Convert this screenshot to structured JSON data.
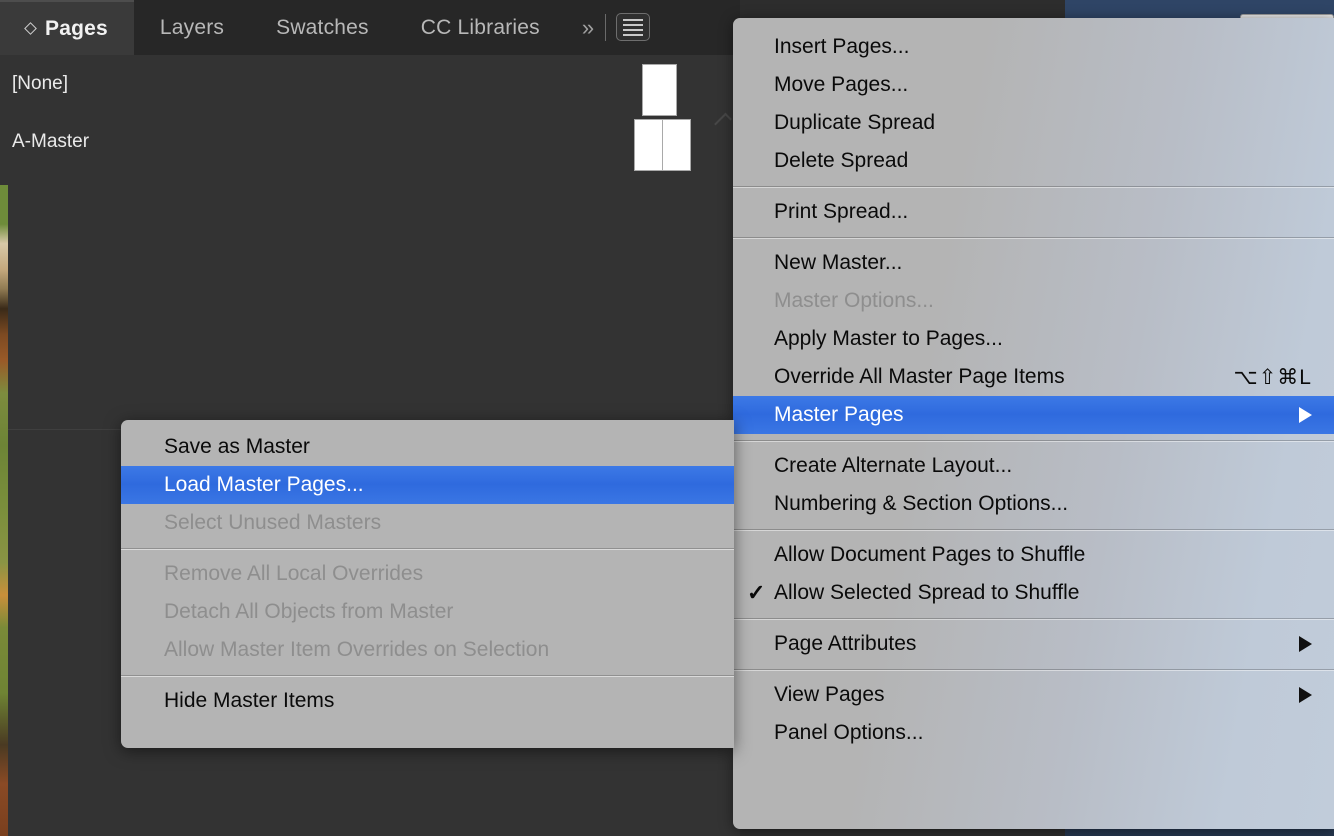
{
  "panel": {
    "tabs": [
      {
        "label": "Pages",
        "active": true,
        "icon": "diamond-icon"
      },
      {
        "label": "Layers",
        "active": false
      },
      {
        "label": "Swatches",
        "active": false
      },
      {
        "label": "CC Libraries",
        "active": false
      }
    ],
    "overflow_label": "»",
    "menu_button_icon": "hamburger-menu-icon",
    "masters": [
      {
        "name": "[None]",
        "thumb": "single-page"
      },
      {
        "name": "A-Master",
        "thumb": "two-page-spread"
      }
    ]
  },
  "context_menu": {
    "groups": [
      {
        "items": [
          {
            "label": "Insert Pages...",
            "state": "normal"
          },
          {
            "label": "Move Pages...",
            "state": "normal"
          },
          {
            "label": "Duplicate Spread",
            "state": "normal"
          },
          {
            "label": "Delete Spread",
            "state": "normal"
          }
        ]
      },
      {
        "items": [
          {
            "label": "Print Spread...",
            "state": "normal"
          }
        ]
      },
      {
        "items": [
          {
            "label": "New Master...",
            "state": "normal"
          },
          {
            "label": "Master Options...",
            "state": "disabled"
          },
          {
            "label": "Apply Master to Pages...",
            "state": "normal"
          },
          {
            "label": "Override All Master Page Items",
            "state": "normal",
            "shortcut": "⌥⇧⌘L"
          },
          {
            "label": "Master Pages",
            "state": "selected",
            "submenu": true
          }
        ]
      },
      {
        "items": [
          {
            "label": "Create Alternate Layout...",
            "state": "normal"
          },
          {
            "label": "Numbering & Section Options...",
            "state": "normal"
          }
        ]
      },
      {
        "items": [
          {
            "label": "Allow Document Pages to Shuffle",
            "state": "normal"
          },
          {
            "label": "Allow Selected Spread to Shuffle",
            "state": "normal",
            "checked": true
          }
        ]
      },
      {
        "items": [
          {
            "label": "Page Attributes",
            "state": "normal",
            "submenu": true
          }
        ]
      },
      {
        "items": [
          {
            "label": "View Pages",
            "state": "normal",
            "submenu": true
          },
          {
            "label": "Panel Options...",
            "state": "normal"
          }
        ]
      }
    ]
  },
  "submenu": {
    "groups": [
      {
        "items": [
          {
            "label": "Save as Master",
            "state": "normal"
          },
          {
            "label": "Load Master Pages...",
            "state": "selected"
          },
          {
            "label": "Select Unused Masters",
            "state": "disabled"
          }
        ]
      },
      {
        "items": [
          {
            "label": "Remove All Local Overrides",
            "state": "disabled"
          },
          {
            "label": "Detach All Objects from Master",
            "state": "disabled"
          },
          {
            "label": "Allow Master Item Overrides on Selection",
            "state": "disabled"
          }
        ]
      },
      {
        "items": [
          {
            "label": "Hide Master Items",
            "state": "normal"
          }
        ]
      }
    ]
  },
  "colors": {
    "highlight_blue": "#2f6ade",
    "menu_gray": "#b4b4b4",
    "menu_blue_tint": "#c1ccda",
    "panel_dark": "#333333",
    "desktop_blue": "#2f4566"
  }
}
